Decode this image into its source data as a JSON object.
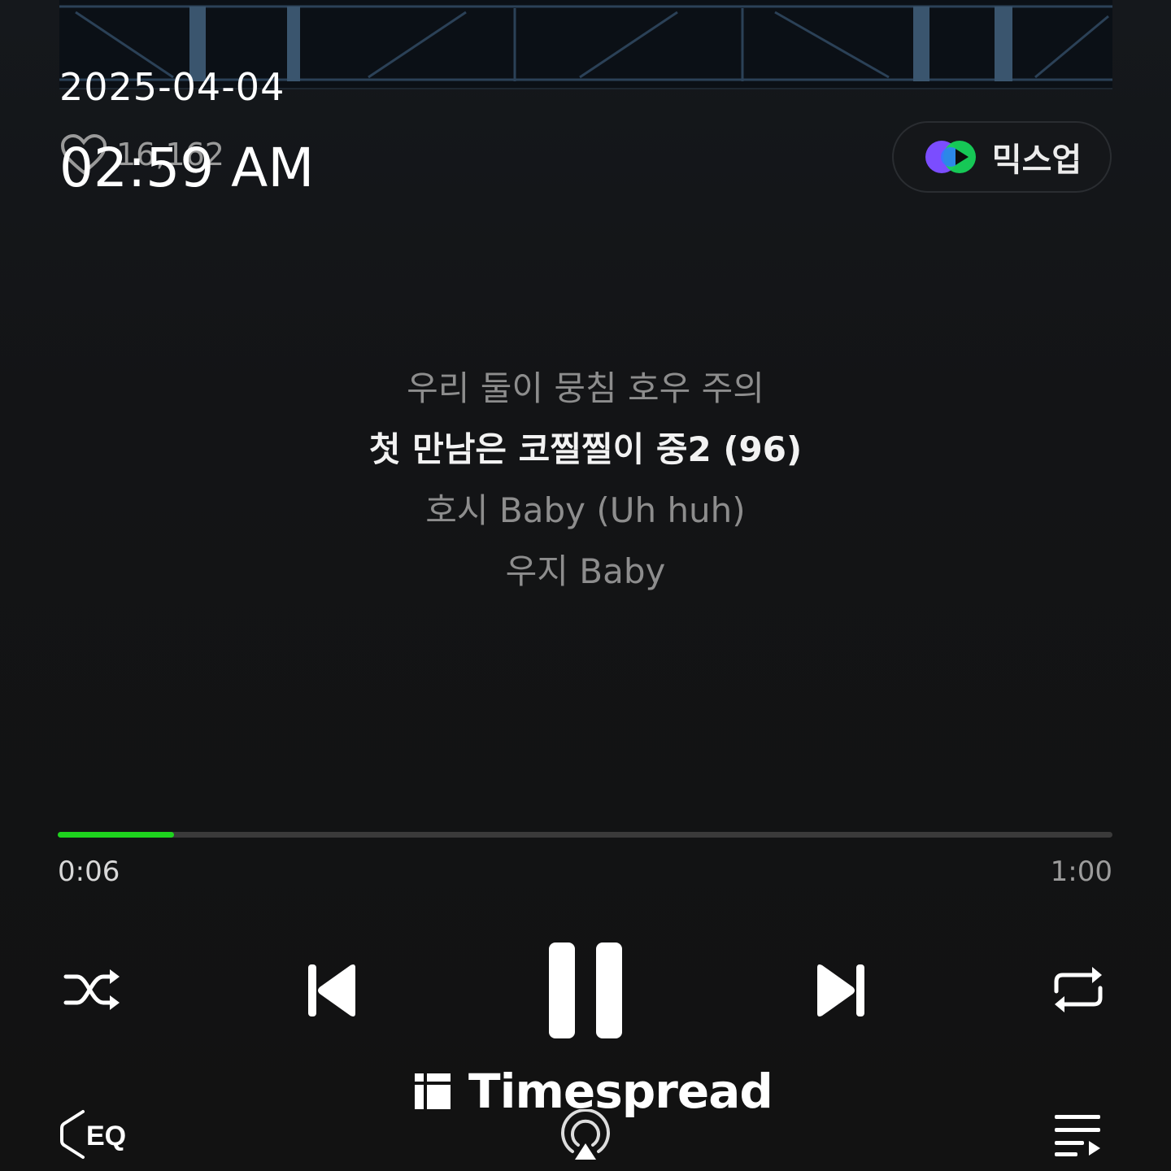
{
  "header": {
    "date": "2025-04-04",
    "time": "02:59 AM",
    "likes_count": "16,162",
    "mixup_label": "믹스업"
  },
  "lyrics": [
    {
      "text": "우리 둘이 뭉침 호우 주의",
      "active": false
    },
    {
      "text": "첫 만남은 코찔찔이 중2 (96)",
      "active": true
    },
    {
      "text": "호시 Baby (Uh huh)",
      "active": false
    },
    {
      "text": "우지 Baby",
      "active": false
    }
  ],
  "playback": {
    "elapsed": "0:06",
    "duration": "1:00",
    "progress_fraction": 0.11,
    "state": "playing"
  },
  "controls": {
    "shuffle": "shuffle-icon",
    "previous": "skip-previous-icon",
    "pause": "pause-icon",
    "next": "skip-next-icon",
    "repeat": "repeat-icon",
    "eq_label": "EQ",
    "cast": "airplay-icon",
    "queue": "playlist-icon"
  },
  "watermark": {
    "text": "Timespread"
  },
  "colors": {
    "accent": "#1ed31e",
    "background": "#121212"
  }
}
